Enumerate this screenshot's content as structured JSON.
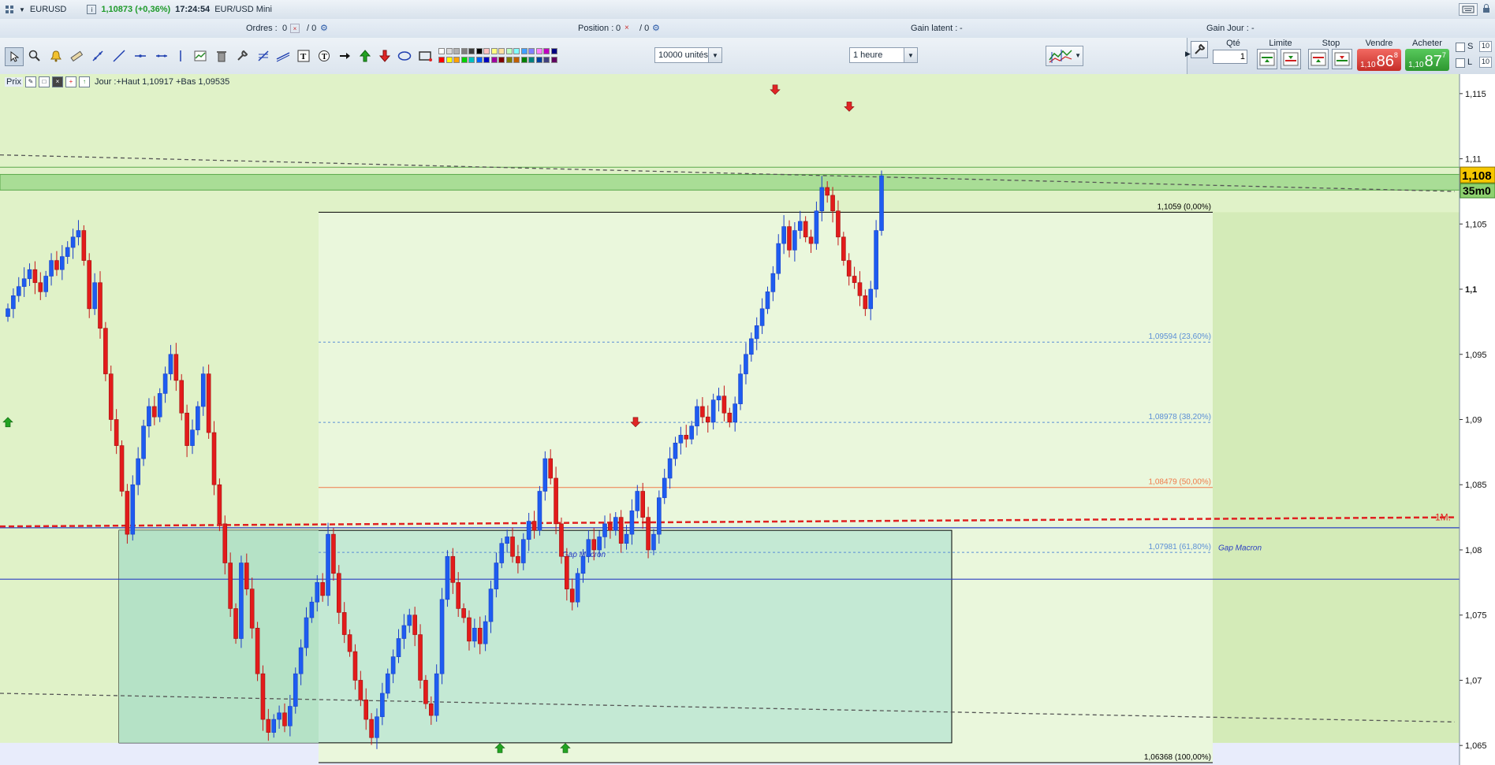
{
  "window": {
    "symbol": "EURUSD",
    "last_price": "1,10873 (+0,36%)",
    "time": "17:24:54",
    "instrument_name": "EUR/USD Mini"
  },
  "infobar": {
    "orders_label": "Ordres :",
    "orders_count": "0",
    "orders_slash": "/ 0",
    "position_label": "Position :",
    "position_count": "0",
    "position_slash": "/ 0",
    "unrealized_label": "Gain latent :",
    "unrealized_value": "-",
    "day_gain_label": "Gain Jour :",
    "day_gain_value": "-"
  },
  "toolbar": {
    "units_select": "10000 unités",
    "timeframe_select": "1 heure",
    "palette": [
      "#ffffff",
      "#d9d9d9",
      "#b0b0b0",
      "#7f7f7f",
      "#404040",
      "#000000",
      "#ffc0c0",
      "#ffff80",
      "#ffe0a0",
      "#c0ffc0",
      "#80ffff",
      "#40a0ff",
      "#8080ff",
      "#ff80ff",
      "#c000c0",
      "#000080",
      "#ff0000",
      "#ffff00",
      "#ffa000",
      "#00d000",
      "#00c0c0",
      "#0060ff",
      "#0000c0",
      "#a000a0",
      "#800000",
      "#808000",
      "#c06000",
      "#008000",
      "#008080",
      "#0040a0",
      "#404080",
      "#600060"
    ]
  },
  "order_panel": {
    "qty_label": "Qté",
    "qty_value": "1",
    "limit_label": "Limite",
    "stop_label": "Stop",
    "sell_label": "Vendre",
    "buy_label": "Acheter",
    "sell_prefix": "1,10",
    "sell_big": "86",
    "sell_sup": "8",
    "buy_prefix": "1,10",
    "buy_big": "87",
    "buy_sup": "7",
    "s_label": "S",
    "l_label": "L",
    "s_value": "10",
    "l_value": "10"
  },
  "chart_header": {
    "price_label": "Prix",
    "day_info": "Jour :+Haut 1,10917 +Bas 1,09535"
  },
  "chart_data": {
    "type": "candlestick",
    "y_axis_ticks": [
      "1,115",
      "1,11",
      "1,105",
      "1,1",
      "1,095",
      "1,09",
      "1,085",
      "1,08",
      "1,075",
      "1,07",
      "1,065"
    ],
    "ylim": [
      1.0635,
      1.1165
    ],
    "current_price_label": "1,108",
    "countdown_label": "35m0",
    "fib_levels": [
      {
        "price": 1.1059,
        "label": "1,1059 (0,00%)",
        "color": "#000000"
      },
      {
        "price": 1.09594,
        "label": "1,09594 (23,60%)",
        "color": "#5b8fd6"
      },
      {
        "price": 1.08978,
        "label": "1,08978 (38,20%)",
        "color": "#5b8fd6"
      },
      {
        "price": 1.08479,
        "label": "1,08479 (50,00%)",
        "color": "#f07a4a"
      },
      {
        "price": 1.07981,
        "label": "1,07981 (61,80%)",
        "color": "#5b8fd6"
      },
      {
        "price": 1.06368,
        "label": "1,06368 (100,00%)",
        "color": "#000000"
      }
    ],
    "annotations": [
      {
        "text": "Gap Macron",
        "price": 1.0797
      },
      {
        "text": "Gap Macron",
        "price": 1.0802
      },
      {
        "text": "1M.",
        "price": 1.0825
      }
    ],
    "candles_close": [
      1.0985,
      1.0995,
      1.1002,
      1.1008,
      1.1015,
      1.1005,
      1.0998,
      1.101,
      1.1022,
      1.1015,
      1.1025,
      1.1032,
      1.104,
      1.1045,
      1.1022,
      1.0985,
      1.1005,
      1.097,
      1.0935,
      1.09,
      1.088,
      1.0845,
      1.0812,
      1.085,
      1.087,
      1.0895,
      1.091,
      1.0902,
      1.092,
      1.0935,
      1.095,
      1.093,
      1.0905,
      1.088,
      1.0892,
      1.091,
      1.0935,
      1.089,
      1.085,
      1.082,
      1.079,
      1.0755,
      1.0732,
      1.079,
      1.077,
      1.074,
      1.0705,
      1.067,
      1.066,
      1.067,
      1.0675,
      1.0665,
      1.068,
      1.0705,
      1.0725,
      1.0748,
      1.076,
      1.0775,
      1.0765,
      1.0812,
      1.0782,
      1.0752,
      1.0735,
      1.0722,
      1.07,
      1.0685,
      1.067,
      1.0656,
      1.0672,
      1.069,
      1.0705,
      1.0718,
      1.0732,
      1.0742,
      1.075,
      1.0735,
      1.07,
      1.0682,
      1.0673,
      1.0705,
      1.0762,
      1.0795,
      1.0775,
      1.0755,
      1.0748,
      1.073,
      1.074,
      1.0728,
      1.0745,
      1.077,
      1.079,
      1.0805,
      1.081,
      1.0795,
      1.079,
      1.0808,
      1.0822,
      1.0815,
      1.0845,
      1.087,
      1.0855,
      1.082,
      1.0795,
      1.077,
      1.076,
      1.0782,
      1.0795,
      1.0808,
      1.08,
      1.081,
      1.082,
      1.0815,
      1.0825,
      1.0805,
      1.0812,
      1.083,
      1.0845,
      1.0825,
      1.08,
      1.0812,
      1.084,
      1.0855,
      1.087,
      1.0882,
      1.0888,
      1.0885,
      1.0895,
      1.091,
      1.0902,
      1.0898,
      1.0915,
      1.0918,
      1.0905,
      1.0898,
      1.0912,
      1.0935,
      1.095,
      1.0962,
      1.0972,
      1.0985,
      1.0998,
      1.1012,
      1.1035,
      1.1048,
      1.103,
      1.1045,
      1.1052,
      1.104,
      1.1035,
      1.106,
      1.1078,
      1.1072,
      1.106,
      1.104,
      1.1022,
      1.101,
      1.1005,
      1.0995,
      1.0985,
      1.1,
      1.1045,
      1.1087
    ]
  }
}
